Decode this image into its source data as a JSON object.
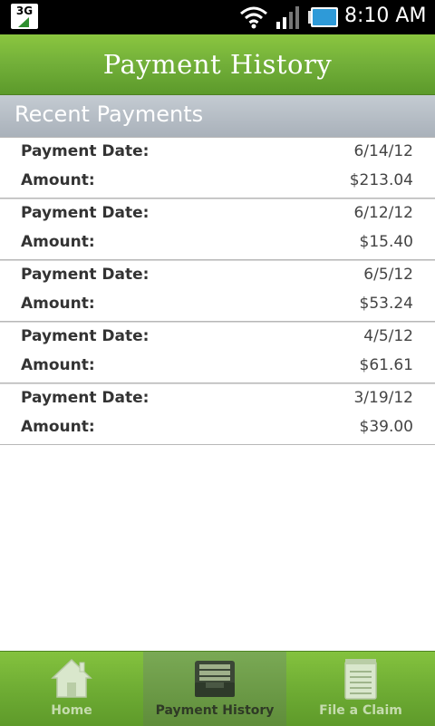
{
  "status_bar": {
    "network": "3G",
    "time": "8:10 AM",
    "icons": [
      "network-3g-icon",
      "wifi-icon",
      "signal-icon",
      "battery-icon"
    ]
  },
  "header": {
    "title": "Payment History"
  },
  "section": {
    "title": "Recent Payments"
  },
  "payments": [
    {
      "date_label": "Payment Date:",
      "date": "6/14/12",
      "amount_label": "Amount:",
      "amount": "$213.04"
    },
    {
      "date_label": "Payment Date:",
      "date": "6/12/12",
      "amount_label": "Amount:",
      "amount": "$15.40"
    },
    {
      "date_label": "Payment Date:",
      "date": "6/5/12",
      "amount_label": "Amount:",
      "amount": "$53.24"
    },
    {
      "date_label": "Payment Date:",
      "date": "4/5/12",
      "amount_label": "Amount:",
      "amount": "$61.61"
    },
    {
      "date_label": "Payment Date:",
      "date": "3/19/12",
      "amount_label": "Amount:",
      "amount": "$39.00"
    }
  ],
  "tabs": [
    {
      "label": "Home",
      "icon": "home-icon",
      "active": false
    },
    {
      "label": "Payment History",
      "icon": "inbox-tray-icon",
      "active": true
    },
    {
      "label": "File a Claim",
      "icon": "notepad-icon",
      "active": false
    }
  ],
  "colors": {
    "header_green": "#74b13a",
    "section_gray": "#b3bbc3",
    "tab_active_text": "#2f3a26",
    "tab_inactive_text": "#c5dcae"
  }
}
